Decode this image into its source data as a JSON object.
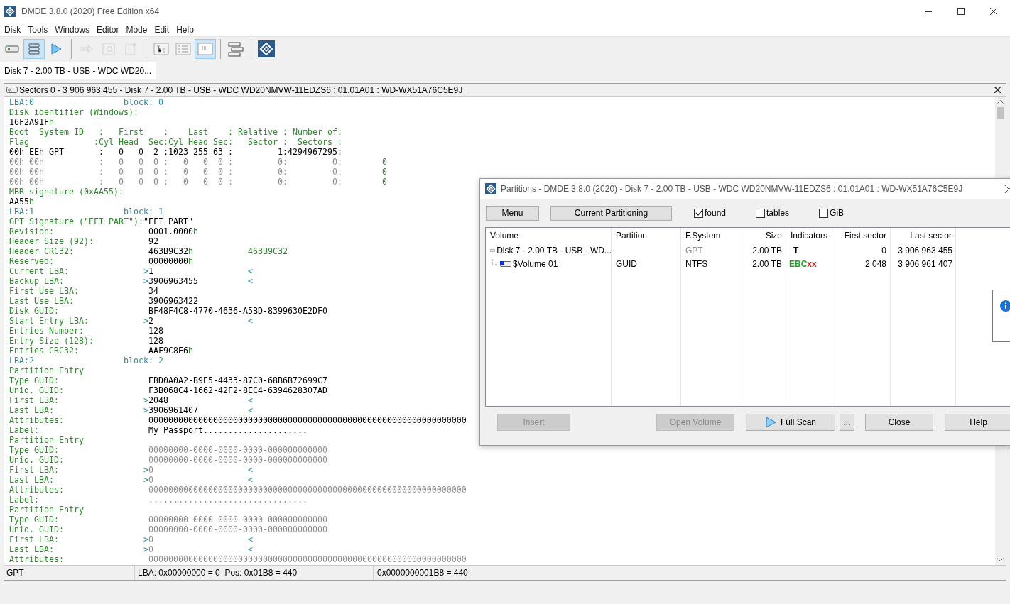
{
  "window": {
    "title": "DMDE 3.8.0 (2020) Free Edition x64"
  },
  "menu": [
    "Disk",
    "Tools",
    "Windows",
    "Editor",
    "Mode",
    "Edit",
    "Help"
  ],
  "toolbar": [
    [
      {
        "kind": "drive",
        "selected": false,
        "disabled": false
      },
      {
        "kind": "list",
        "selected": true,
        "disabled": false
      },
      {
        "kind": "play",
        "selected": false,
        "disabled": false
      }
    ],
    [
      {
        "kind": "step",
        "selected": false,
        "disabled": true
      },
      {
        "kind": "find",
        "selected": false,
        "disabled": true
      },
      {
        "kind": "new",
        "selected": false,
        "disabled": true
      }
    ],
    [
      {
        "kind": "tree",
        "selected": false,
        "disabled": false
      },
      {
        "kind": "details",
        "selected": false,
        "disabled": false
      },
      {
        "kind": "grid",
        "selected": true,
        "disabled": false
      }
    ],
    [
      {
        "kind": "stack",
        "selected": false,
        "disabled": false
      }
    ],
    [
      {
        "kind": "logo",
        "selected": false,
        "disabled": false
      }
    ]
  ],
  "tabs": [
    {
      "label": "Disk 7 - 2.00 TB - USB - WDC WD20...",
      "selected": true
    }
  ],
  "panel": {
    "title": "Sectors 0 - 3 906 963 455 - Disk 7 - 2.00 TB - USB - WDC WD20NMVW-11EDZS6 : 01.01A01 : WD-WX51A76C5E9J"
  },
  "text_view": {
    "lines": [
      {
        "kind": "block",
        "lba": "LBA:0",
        "block": "block: 0"
      },
      {
        "kind": "heading",
        "text": "Disk identifier (Windows):"
      },
      {
        "kind": "value",
        "value": "16F2A91F",
        "suffix": "h"
      },
      {
        "kind": "heading",
        "text": "Boot  System ID   :   First    :    Last    : Relative : Number of:"
      },
      {
        "kind": "heading",
        "text": "Flag             :Cyl Head  Sec:Cyl Head Sec:   Sector :  Sectors :"
      },
      {
        "kind": "mbr",
        "text": "00h EEh GPT       :   0   0  2 :1023 255 63 :         1:4294967295:",
        "empty": false
      },
      {
        "kind": "mbr",
        "text": "00h 00h           :   0   0  0 :   0   0  0 :         0:         0:",
        "empty": true,
        "extra": "0"
      },
      {
        "kind": "mbr",
        "text": "00h 00h           :   0   0  0 :   0   0  0 :         0:         0:",
        "empty": true,
        "extra": "0"
      },
      {
        "kind": "mbr",
        "text": "00h 00h           :   0   0  0 :   0   0  0 :         0:         0:",
        "empty": true,
        "extra": "0"
      },
      {
        "kind": "heading",
        "text": "MBR signature (0xAA55):"
      },
      {
        "kind": "value",
        "value": "AA55",
        "suffix": "h"
      },
      {
        "kind": "block",
        "lba": "LBA:1",
        "block": "block: 1"
      },
      {
        "kind": "pair",
        "label": "GPT Signature (\"EFI PART\"):",
        "value": "\"EFI PART\""
      },
      {
        "kind": "field",
        "label": "Revision:",
        "value": "0001.0000",
        "suffix": "h",
        "empty": false
      },
      {
        "kind": "field",
        "label": "Header Size (92):",
        "value": "92",
        "empty": false
      },
      {
        "kind": "field",
        "label": "Header CRC32:",
        "value": "463B9C32",
        "suffix": "h",
        "check": "463B9C32",
        "empty": false
      },
      {
        "kind": "field",
        "label": "Reserved:",
        "value": "00000000",
        "suffix": "h",
        "empty": false
      },
      {
        "kind": "field",
        "label": "Current LBA:",
        "open": ">",
        "value": "1",
        "close": "<",
        "empty": false
      },
      {
        "kind": "field",
        "label": "Backup LBA:",
        "open": ">",
        "value": "3906963455",
        "close": "<",
        "empty": false
      },
      {
        "kind": "field",
        "label": "First Use LBA:",
        "value": "34",
        "empty": false
      },
      {
        "kind": "field",
        "label": "Last Use LBA:",
        "value": "3906963422",
        "empty": false
      },
      {
        "kind": "field",
        "label": "Disk GUID:",
        "value": "BF48F4C8-4770-4636-A5BD-8399630E2DF0",
        "empty": false
      },
      {
        "kind": "field",
        "label": "Start Entry LBA:",
        "open": ">",
        "value": "2",
        "close": "<",
        "empty": false
      },
      {
        "kind": "field",
        "label": "Entries Number:",
        "value": "128",
        "empty": false
      },
      {
        "kind": "field",
        "label": "Entry Size (128):",
        "value": "128",
        "empty": false
      },
      {
        "kind": "field",
        "label": "Entries CRC32:",
        "value": "AAF9C8E6",
        "suffix": "h",
        "empty": false
      },
      {
        "kind": "block",
        "lba": "LBA:2",
        "block": "block: 2"
      },
      {
        "kind": "heading",
        "text": "Partition Entry"
      },
      {
        "kind": "field",
        "label": "Type GUID:",
        "value": "EBD0A0A2-B9E5-4433-87C0-68B6B72699C7",
        "empty": false
      },
      {
        "kind": "field",
        "label": "Uniq. GUID:",
        "value": "F3B068C4-1662-42F2-8EC4-6394628307AD",
        "empty": false
      },
      {
        "kind": "field",
        "label": "First LBA:",
        "open": ">",
        "value": "2048",
        "close": "<",
        "empty": false
      },
      {
        "kind": "field",
        "label": "Last LBA:",
        "open": ">",
        "value": "3906961407",
        "close": "<",
        "empty": false
      },
      {
        "kind": "field",
        "label": "Attributes:",
        "value": "0000000000000000000000000000000000000000000000000000000000000000",
        "empty": false
      },
      {
        "kind": "field",
        "label": "Label:",
        "value": "My Passport.....................",
        "empty": false
      },
      {
        "kind": "heading",
        "text": "Partition Entry"
      },
      {
        "kind": "field",
        "label": "Type GUID:",
        "value": "00000000-0000-0000-0000-000000000000",
        "empty": true
      },
      {
        "kind": "field",
        "label": "Uniq. GUID:",
        "value": "00000000-0000-0000-0000-000000000000",
        "empty": true
      },
      {
        "kind": "field",
        "label": "First LBA:",
        "open": ">",
        "value": "0",
        "close": "<",
        "empty": true
      },
      {
        "kind": "field",
        "label": "Last LBA:",
        "open": ">",
        "value": "0",
        "close": "<",
        "empty": true
      },
      {
        "kind": "field",
        "label": "Attributes:",
        "value": "0000000000000000000000000000000000000000000000000000000000000000",
        "empty": true
      },
      {
        "kind": "field",
        "label": "Label:",
        "value": "................................",
        "empty": true
      },
      {
        "kind": "heading",
        "text": "Partition Entry"
      },
      {
        "kind": "field",
        "label": "Type GUID:",
        "value": "00000000-0000-0000-0000-000000000000",
        "empty": true
      },
      {
        "kind": "field",
        "label": "Uniq. GUID:",
        "value": "00000000-0000-0000-0000-000000000000",
        "empty": true
      },
      {
        "kind": "field",
        "label": "First LBA:",
        "open": ">",
        "value": "0",
        "close": "<",
        "empty": true
      },
      {
        "kind": "field",
        "label": "Last LBA:",
        "open": ">",
        "value": "0",
        "close": "<",
        "empty": true
      },
      {
        "kind": "field",
        "label": "Attributes:",
        "value": "0000000000000000000000000000000000000000000000000000000000000000",
        "empty": true
      }
    ]
  },
  "status_bar": [
    "GPT",
    "LBA: 0x00000000 = 0  Pos: 0x01B8 = 440",
    "0x0000000001B8 = 440"
  ],
  "dialog": {
    "title": "Partitions - DMDE 3.8.0 (2020) - Disk 7 - 2.00 TB - USB - WDC WD20NMVW-11EDZS6 : 01.01A01 : WD-WX51A76C5E9J",
    "buttons": [
      "Menu",
      "Current Partitioning"
    ],
    "checkboxes": [
      {
        "label": "found",
        "checked": true
      },
      {
        "label": "tables",
        "checked": false
      },
      {
        "label": "GiB",
        "checked": false
      }
    ],
    "columns": [
      "Volume",
      "Partition",
      "F.System",
      "Size",
      "Indicators",
      "First sector",
      "Last sector"
    ],
    "rows": [
      {
        "kind": "disk",
        "volume": "Disk 7 - 2.00 TB - USB - WD...",
        "fs": "GPT",
        "fs_greyed": true,
        "size": "2.00 TB",
        "indicators": [
          {
            "text": "T",
            "color": "#000000"
          }
        ],
        "first": "0",
        "last": "3 906 963 455",
        "children": [
          {
            "kind": "volume",
            "volume": "$Volume 01",
            "partition": "GUID",
            "fs": "NTFS",
            "fs_greyed": false,
            "size": "2.00 TB",
            "indicators": [
              {
                "text": "EBC",
                "color": "#22a022"
              },
              {
                "text": "xx",
                "color": "#e02020"
              }
            ],
            "first": "2 048",
            "last": "3 906 961 407"
          }
        ]
      }
    ],
    "footer_buttons": [
      {
        "label": "Insert",
        "disabled": true
      },
      {
        "label": "Open Volume",
        "disabled": true
      },
      {
        "label": "Full Scan",
        "disabled": false,
        "kind": "play"
      },
      {
        "label": "...",
        "disabled": false
      },
      {
        "label": "Close",
        "disabled": false
      },
      {
        "label": "Help",
        "disabled": false
      }
    ]
  }
}
